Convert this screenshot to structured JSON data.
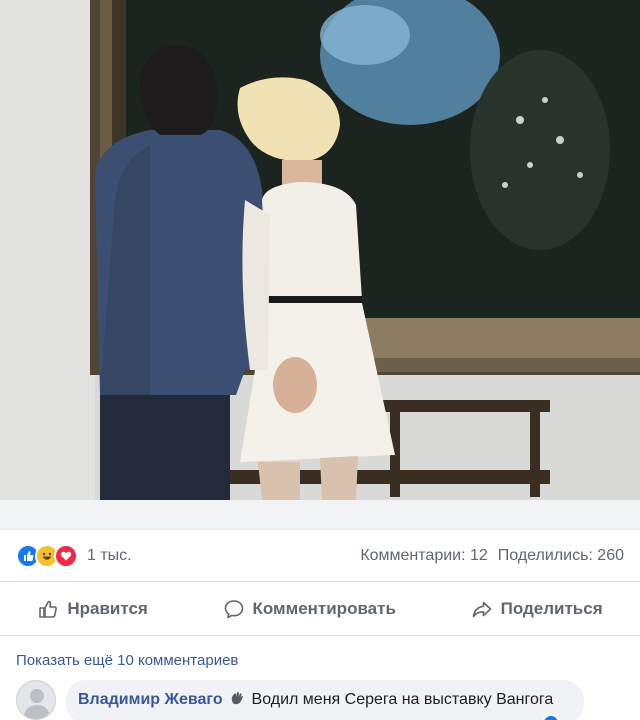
{
  "post": {
    "photo": {
      "icon": "gallery-couple-photo",
      "colors": {
        "wall": "#d8d8d6",
        "frame": "#4e4536",
        "canvas": "#1d2320",
        "jacket": "#3c4f72",
        "dress": "#f2efe8",
        "hair": "#f1e2b4"
      }
    },
    "reactions": {
      "icons": [
        "like-reaction-icon",
        "haha-reaction-icon",
        "love-reaction-icon"
      ],
      "count": "1 тыс."
    },
    "stats": {
      "comments": "Комментарии: 12",
      "shares": "Поделились: 260"
    },
    "actions": {
      "like": "Нравится",
      "comment": "Комментировать",
      "share": "Поделиться"
    },
    "comments": {
      "show_more": "Показать ещё 10 комментариев",
      "items": [
        {
          "author": "Владимир Жеваго",
          "text": "Водил меня Серега на выставку Вангога"
        }
      ]
    },
    "colors": {
      "accent": "#1877f2",
      "link": "#385898",
      "muted": "#606770",
      "bubble": "#f0f2f5"
    }
  }
}
